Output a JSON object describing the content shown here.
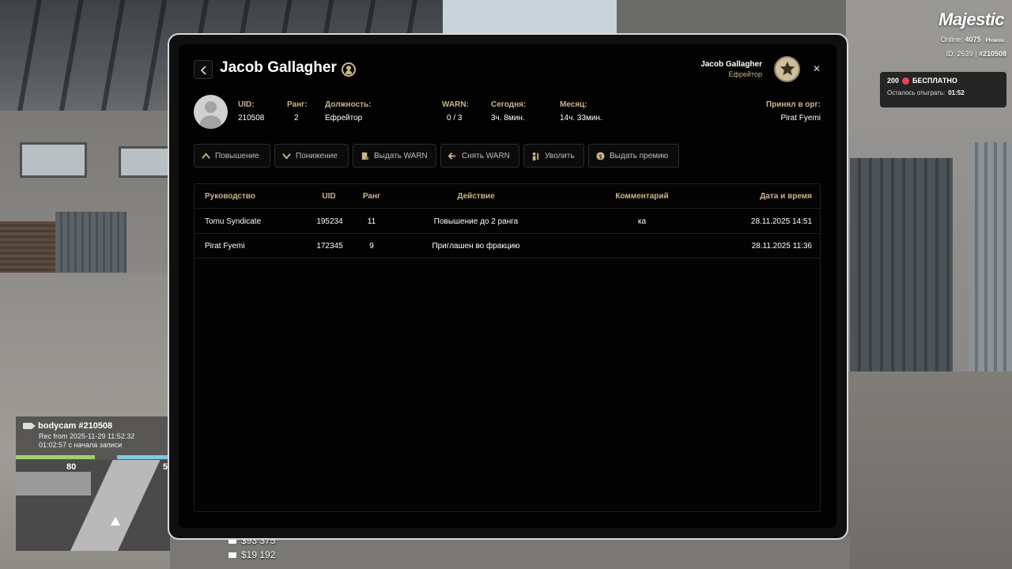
{
  "hud": {
    "logo": "Majestic",
    "online_label": "Online:",
    "online_count": "4075",
    "server": "Phoenix",
    "id_label": "ID:",
    "id_value": "2639",
    "id_sep": "|",
    "static_id": "#210508",
    "promo_amount": "200",
    "promo_text": "БЕСПЛАТНО",
    "promo_remaining_label": "Осталось отыграть:",
    "promo_remaining_time": "01:52"
  },
  "bodycam": {
    "title": "bodycam #210508",
    "rec_from": "Rec from 2025-11-29 11:52:32",
    "elapsed": "01:02:57 с начала записи",
    "map_num_left": "80",
    "map_num_right": "5"
  },
  "money": {
    "cash": "$93 375",
    "bank": "$19 192"
  },
  "profile": {
    "name": "Jacob Gallagher",
    "current_user_name": "Jacob Gallagher",
    "current_user_rank": "Ефрейтор",
    "uid_label": "UID:",
    "uid": "210508",
    "rank_label": "Ранг:",
    "rank": "2",
    "position_label": "Должность:",
    "position": "Ефрейтор",
    "warn_label": "WARN:",
    "warn": "0 / 3",
    "today_label": "Сегодня:",
    "today": "3ч. 8мин.",
    "month_label": "Месяц:",
    "month": "14ч. 33мин.",
    "accepted_label": "Принял в орг:",
    "accepted_by": "Pirat Fyemi"
  },
  "actions": {
    "promote": "Повышение",
    "demote": "Понижение",
    "give_warn": "Выдать WARN",
    "remove_warn": "Снять WARN",
    "fire": "Уволить",
    "bonus": "Выдать премию"
  },
  "table": {
    "headers": {
      "manager": "Руководство",
      "uid": "UID",
      "rank": "Ранг",
      "action": "Действие",
      "comment": "Комментарий",
      "datetime": "Дата и время"
    },
    "rows": [
      {
        "manager": "Tomu Syndicate",
        "uid": "195234",
        "rank": "11",
        "action": "Повышение до 2 ранга",
        "comment": "ка",
        "datetime": "28.11.2025 14:51"
      },
      {
        "manager": "Pirat Fyemi",
        "uid": "172345",
        "rank": "9",
        "action": "Приглашен во фракцию",
        "comment": "",
        "datetime": "28.11.2025 11:36"
      }
    ]
  },
  "colors": {
    "accent_gold": "#c9b58a",
    "modal_bg": "#020202",
    "promo_dot": "#e8445a"
  }
}
